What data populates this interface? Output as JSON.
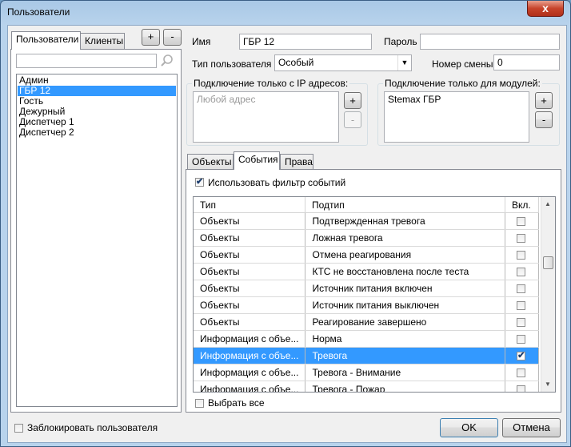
{
  "window": {
    "title": "Пользователи",
    "close_glyph": "x"
  },
  "left": {
    "tabs": [
      "Пользователи",
      "Клиенты"
    ],
    "add_label": "+",
    "remove_label": "-",
    "search_value": "",
    "users": [
      "Админ",
      "ГБР 12",
      "Гость",
      "Дежурный",
      "Диспетчер 1",
      "Диспетчер 2"
    ],
    "selected_index": 1
  },
  "form": {
    "name_label": "Имя",
    "name_value": "ГБР 12",
    "password_label": "Пароль",
    "password_value": "",
    "type_label": "Тип пользователя",
    "type_value": "Особый",
    "shift_label": "Номер смены",
    "shift_value": "0"
  },
  "ip_group": {
    "title": "Подключение только с IP адресов:",
    "placeholder": "Любой адрес",
    "add": "+",
    "remove": "-"
  },
  "modules_group": {
    "title": "Подключение только для модулей:",
    "items": [
      "Stemax ГБР"
    ],
    "add": "+",
    "remove": "-"
  },
  "tabs": [
    "Объекты",
    "События",
    "Права"
  ],
  "active_tab": 1,
  "events": {
    "use_filter_label": "Использовать фильтр событий",
    "use_filter_checked": true,
    "columns": [
      "Тип",
      "Подтип",
      "Вкл."
    ],
    "rows": [
      {
        "type": "Объекты",
        "subtype": "Подтвержденная тревога",
        "on": false
      },
      {
        "type": "Объекты",
        "subtype": "Ложная тревога",
        "on": false
      },
      {
        "type": "Объекты",
        "subtype": "Отмена реагирования",
        "on": false
      },
      {
        "type": "Объекты",
        "subtype": "КТС не восстановлена после теста",
        "on": false
      },
      {
        "type": "Объекты",
        "subtype": "Источник питания включен",
        "on": false
      },
      {
        "type": "Объекты",
        "subtype": "Источник питания выключен",
        "on": false
      },
      {
        "type": "Объекты",
        "subtype": "Реагирование завершено",
        "on": false
      },
      {
        "type": "Информация с объе...",
        "subtype": "Норма",
        "on": false
      },
      {
        "type": "Информация с объе...",
        "subtype": "Тревога",
        "on": true
      },
      {
        "type": "Информация с объе...",
        "subtype": "Тревога - Внимание",
        "on": false
      },
      {
        "type": "Информация с объе...",
        "subtype": "Тревога - Пожар",
        "on": false
      }
    ],
    "selected_row": 8,
    "select_all_label": "Выбрать все"
  },
  "footer": {
    "lock_label": "Заблокировать пользователя",
    "ok_label": "OK",
    "cancel_label": "Отмена"
  },
  "colors": {
    "selection": "#3399ff",
    "frame": "#b8d3ec",
    "close": "#c7442c"
  },
  "icons": {
    "search": "search-icon",
    "dropdown": "chevron-down-icon",
    "scroll_up": "scroll-up-icon",
    "scroll_down": "scroll-down-icon"
  }
}
